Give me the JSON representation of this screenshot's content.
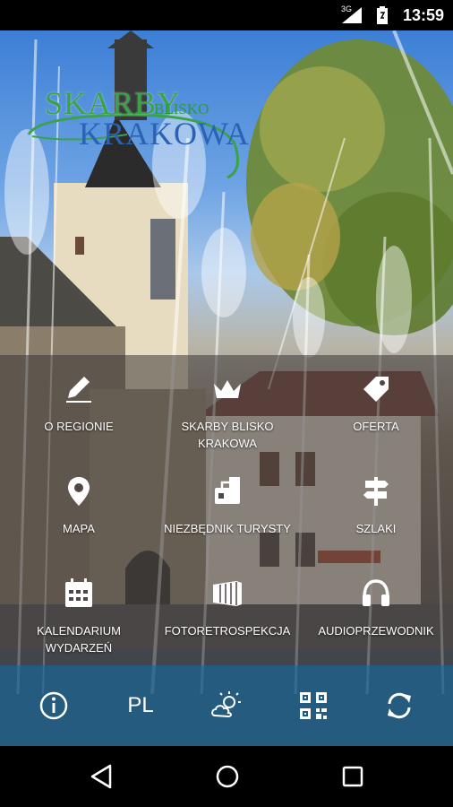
{
  "status_bar": {
    "network": "3G",
    "time": "13:59",
    "icons": [
      "signal-icon",
      "battery-icon"
    ]
  },
  "logo": {
    "line1": "SKARBY",
    "line2": "BLISKO",
    "line3": "KRAKOWA"
  },
  "menu": {
    "items": [
      {
        "label": "O REGIONIE",
        "icon": "pen-icon"
      },
      {
        "label": "SKARBY BLISKO KRAKOWA",
        "icon": "crown-icon"
      },
      {
        "label": "OFERTA",
        "icon": "tag-icon"
      },
      {
        "label": "MAPA",
        "icon": "map-pin-icon"
      },
      {
        "label": "NIEZBĘDNIK TURYSTY",
        "icon": "luggage-icon"
      },
      {
        "label": "SZLAKI",
        "icon": "signpost-icon"
      },
      {
        "label": "KALENDARIUM WYDARZEŃ",
        "icon": "calendar-icon"
      },
      {
        "label": "FOTORETROSPEKCJA",
        "icon": "photo-film-icon"
      },
      {
        "label": "AUDIOPRZEWODNIK",
        "icon": "headphones-icon"
      }
    ]
  },
  "toolbar": {
    "info_icon": "info-icon",
    "language": "PL",
    "weather_icon": "weather-icon",
    "qr_icon": "qr-code-icon",
    "refresh_icon": "refresh-icon"
  },
  "nav_bar": {
    "icons": [
      "back-icon",
      "home-icon",
      "recents-icon"
    ]
  },
  "colors": {
    "toolbar_bg": "#1c5c84",
    "logo_green": "#3aa34a",
    "logo_blue": "#2a63b4"
  }
}
